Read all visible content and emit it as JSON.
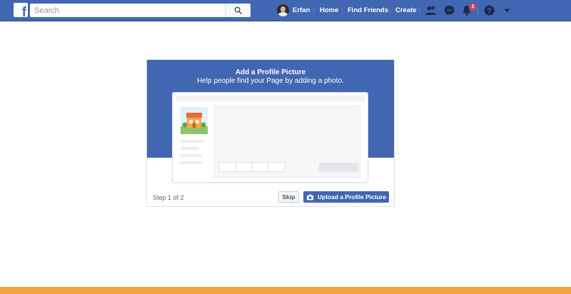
{
  "colors": {
    "brand": "#4267b2",
    "badge": "#fa3e3e",
    "page_background": "#ffffff",
    "bottom_strip": "#f5a23c"
  },
  "topbar": {
    "logo_letter": "f",
    "search": {
      "placeholder": "Search",
      "value": "",
      "icon": "search-icon"
    },
    "user": {
      "name": "Erfan",
      "icon": "avatar"
    },
    "nav": {
      "home": "Home",
      "find_friends": "Find Friends",
      "create": "Create"
    },
    "icons": {
      "friend_requests": "friend-requests-icon",
      "messages": "messenger-icon",
      "notifications": "bell-icon",
      "help": "question-icon",
      "menu": "caret-down-icon"
    },
    "notification_count": "1"
  },
  "dialog": {
    "title": "Add a Profile Picture",
    "subtitle": "Help people find your Page by adding a photo.",
    "step": "Step 1 of 2",
    "skip_label": "Skip",
    "upload_label": "Upload a Profile Picture",
    "upload_icon": "camera-icon",
    "preview_photo_icon": "storefront-icon"
  }
}
